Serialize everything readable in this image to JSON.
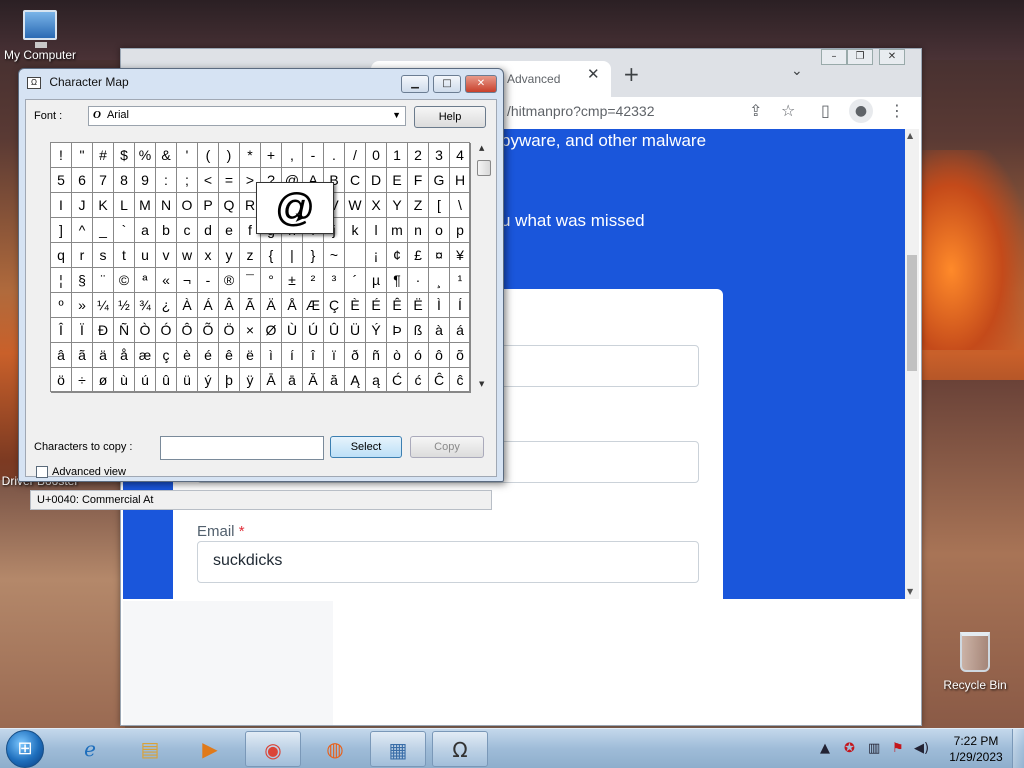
{
  "desktop": {
    "icons": [
      {
        "label": "My Computer"
      },
      {
        "label": "Driver Booster 10"
      },
      {
        "label": "Recycle Bin"
      }
    ]
  },
  "browser": {
    "tab_title": "r: Advanced",
    "url": "/hitmanpro?cmp=42332",
    "page": {
      "line1": "pyware, and other malware",
      "line2": "u what was missed",
      "email_label": "Email",
      "email_required": "*",
      "email_value": "suckdicks"
    }
  },
  "charmap": {
    "title": "Character Map",
    "font_label": "Font :",
    "font_value": "Arial",
    "help_label": "Help",
    "zoomed_char": "@",
    "grid_rows": [
      [
        "!",
        "\"",
        "#",
        "$",
        "%",
        "&",
        "'",
        "(",
        ")",
        "*",
        "+",
        ",",
        "-",
        ".",
        "/",
        "0",
        "1",
        "2",
        "3",
        "4"
      ],
      [
        "5",
        "6",
        "7",
        "8",
        "9",
        ":",
        ";",
        "<",
        "=",
        ">",
        "?",
        "@",
        "A",
        "B",
        "C",
        "D",
        "E",
        "F",
        "G",
        "H"
      ],
      [
        "I",
        "J",
        "K",
        "L",
        "M",
        "N",
        "O",
        "P",
        "Q",
        "R",
        "S",
        "T",
        "U",
        "V",
        "W",
        "X",
        "Y",
        "Z",
        "[",
        "\\"
      ],
      [
        "]",
        "^",
        "_",
        "`",
        "a",
        "b",
        "c",
        "d",
        "e",
        "f",
        "g",
        "h",
        "i",
        "j",
        "k",
        "l",
        "m",
        "n",
        "o",
        "p"
      ],
      [
        "q",
        "r",
        "s",
        "t",
        "u",
        "v",
        "w",
        "x",
        "y",
        "z",
        "{",
        "|",
        "}",
        "~",
        " ",
        "¡",
        "¢",
        "£",
        "¤",
        "¥"
      ],
      [
        "¦",
        "§",
        "¨",
        "©",
        "ª",
        "«",
        "¬",
        "-",
        "®",
        "¯",
        "°",
        "±",
        "²",
        "³",
        "´",
        "µ",
        "¶",
        "·",
        "¸",
        "¹"
      ],
      [
        "º",
        "»",
        "¼",
        "½",
        "¾",
        "¿",
        "À",
        "Á",
        "Â",
        "Ã",
        "Ä",
        "Å",
        "Æ",
        "Ç",
        "È",
        "É",
        "Ê",
        "Ë",
        "Ì",
        "Í"
      ],
      [
        "Î",
        "Ï",
        "Ð",
        "Ñ",
        "Ò",
        "Ó",
        "Ô",
        "Õ",
        "Ö",
        "×",
        "Ø",
        "Ù",
        "Ú",
        "Û",
        "Ü",
        "Ý",
        "Þ",
        "ß",
        "à",
        "á"
      ],
      [
        "â",
        "ã",
        "ä",
        "å",
        "æ",
        "ç",
        "è",
        "é",
        "ê",
        "ë",
        "ì",
        "í",
        "î",
        "ï",
        "ð",
        "ñ",
        "ò",
        "ó",
        "ô",
        "õ"
      ],
      [
        "ö",
        "÷",
        "ø",
        "ù",
        "ú",
        "û",
        "ü",
        "ý",
        "þ",
        "ÿ",
        "Ā",
        "ā",
        "Ă",
        "ă",
        "Ą",
        "ą",
        "Ć",
        "ć",
        "Ĉ",
        "ĉ"
      ]
    ],
    "copy_label": "Characters to copy :",
    "copy_value": "",
    "select_label": "Select",
    "copy_button": "Copy",
    "advanced_label": "Advanced view",
    "status": "U+0040: Commercial At"
  },
  "taskbar": {
    "clock_time": "7:22 PM",
    "clock_date": "1/29/2023"
  }
}
